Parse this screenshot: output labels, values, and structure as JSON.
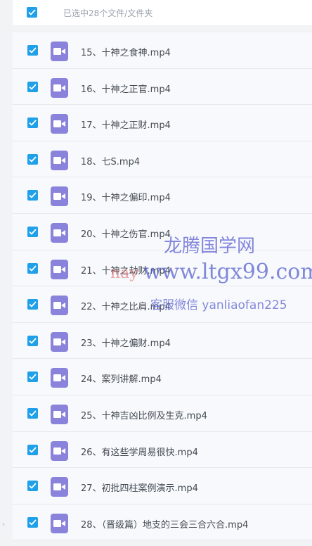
{
  "selection": {
    "label": "已选中28个文件/文件夹"
  },
  "files": [
    "15、十神之食神.mp4",
    "16、十神之正官.mp4",
    "17、十神之正财.mp4",
    "18、七S.mp4",
    "19、十神之偏印.mp4",
    "20、十神之伤官.mp4",
    "21、十神之劫财.mp4",
    "22、十神之比肩.mp4",
    "23、十神之偏财.mp4",
    "24、案列讲解.mp4",
    "25、十神吉凶比例及生克.mp4",
    "26、有这些学周易很快.mp4",
    "27、初批四柱案例演示.mp4",
    "28、（晋级篇）地支的三会三合六合.mp4"
  ],
  "watermark": {
    "site_name": "龙腾国学网",
    "red_text": "nay",
    "url": "www.ltgx99.com",
    "contact": "客服微信 yanliaofan225"
  },
  "colors": {
    "checkbox": "#1fa0e8",
    "video_icon": "#8a83dc"
  }
}
